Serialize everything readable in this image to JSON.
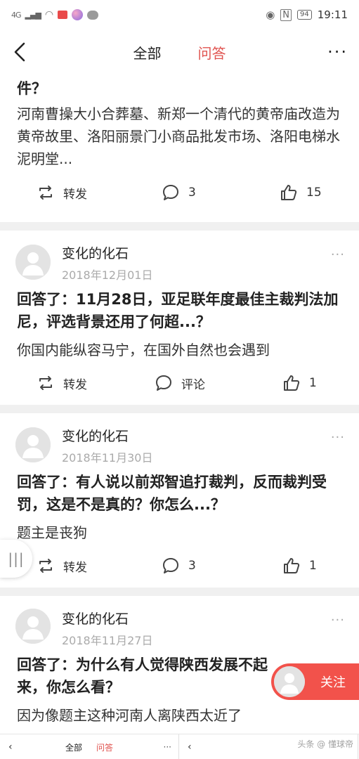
{
  "statusbar": {
    "signal": "4G",
    "battery": "94",
    "time": "19:11"
  },
  "nav": {
    "tab_all": "全部",
    "tab_qa": "问答",
    "more": "···"
  },
  "feed": {
    "card0": {
      "title_tail": "件？",
      "body": "河南曹操大小合葬墓、新郑一个清代的黄帝庙改造为黄帝故里、洛阳丽景门小商品批发市场、洛阳电梯水泥明堂...",
      "repost": "转发",
      "comments": "3",
      "likes": "15"
    },
    "card1": {
      "author": "变化的化石",
      "date": "2018年12月01日",
      "title": "回答了：11月28日，亚足联年度最佳主裁判法加尼，评选背景还用了何超...？",
      "body": "你国内能纵容马宁，在国外自然也会遇到",
      "repost": "转发",
      "comments": "评论",
      "likes": "1"
    },
    "card2": {
      "author": "变化的化石",
      "date": "2018年11月30日",
      "title": "回答了：有人说以前郑智追打裁判，反而裁判受罚，这是不是真的？你怎么...？",
      "body": "题主是丧狗",
      "repost": "转发",
      "comments": "3",
      "likes": "1"
    },
    "card3": {
      "author": "变化的化石",
      "date": "2018年11月27日",
      "title": "回答了：为什么有人觉得陕西发展不起来，你怎么看？",
      "body": "因为像题主这种河南人离陕西太近了"
    }
  },
  "follow_button": "关注",
  "side_handle": "|||",
  "bottom": {
    "tab_all": "全部",
    "tab_qa": "问答",
    "watermark": "头条 @ 懂球帝"
  },
  "colors": {
    "accent": "#e0534f",
    "follow": "#f2524b",
    "separator": "#f0f0f0"
  }
}
